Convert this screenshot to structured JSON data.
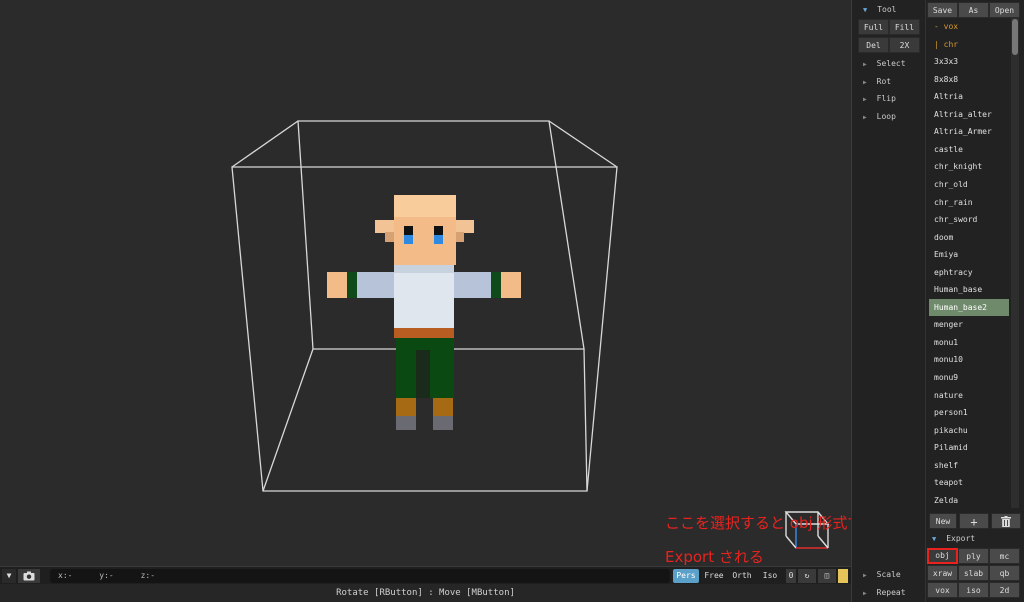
{
  "viewport": {
    "annotation_line1": "ここを選択すると obj 形式で",
    "annotation_line2": "Export される"
  },
  "bottombar": {
    "x_label": "x:-",
    "y_label": "y:-",
    "z_label": "z:-",
    "modes": [
      "Pers",
      "Free",
      "Orth",
      "Iso"
    ],
    "active_mode": "Pers",
    "counter": "0"
  },
  "status": {
    "text": "Rotate [RButton] : Move [MButton]"
  },
  "tools": {
    "tool_header": "Tool",
    "full": "Full",
    "fill": "Fill",
    "del": "Del",
    "twox": "2X",
    "collapsibles": [
      "Select",
      "Rot",
      "Flip",
      "Loop"
    ],
    "scale": "Scale",
    "repeat": "Repeat"
  },
  "files": {
    "save": "Save",
    "as": "As",
    "open": "Open",
    "items": [
      "- vox",
      "| chr",
      "3x3x3",
      "8x8x8",
      "Altria",
      "Altria_alter",
      "Altria_Armer",
      "castle",
      "chr_knight",
      "chr_old",
      "chr_rain",
      "chr_sword",
      "doom",
      "Emiya",
      "ephtracy",
      "Human_base",
      "Human_base2",
      "menger",
      "monu1",
      "monu10",
      "monu9",
      "nature",
      "person1",
      "pikachu",
      "Pilamid",
      "shelf",
      "teapot",
      "Zelda"
    ],
    "selected": "Human_base2",
    "new": "New",
    "plus": "+",
    "export_header": "Export",
    "export_buttons": [
      "obj",
      "ply",
      "mc",
      "xraw",
      "slab",
      "qb",
      "vox",
      "iso",
      "2d"
    ]
  },
  "colors": {
    "accent": "#5aa0c8",
    "selected": "#6e8a6a",
    "annotation": "#e8231e",
    "folder": "#d99a2a"
  }
}
